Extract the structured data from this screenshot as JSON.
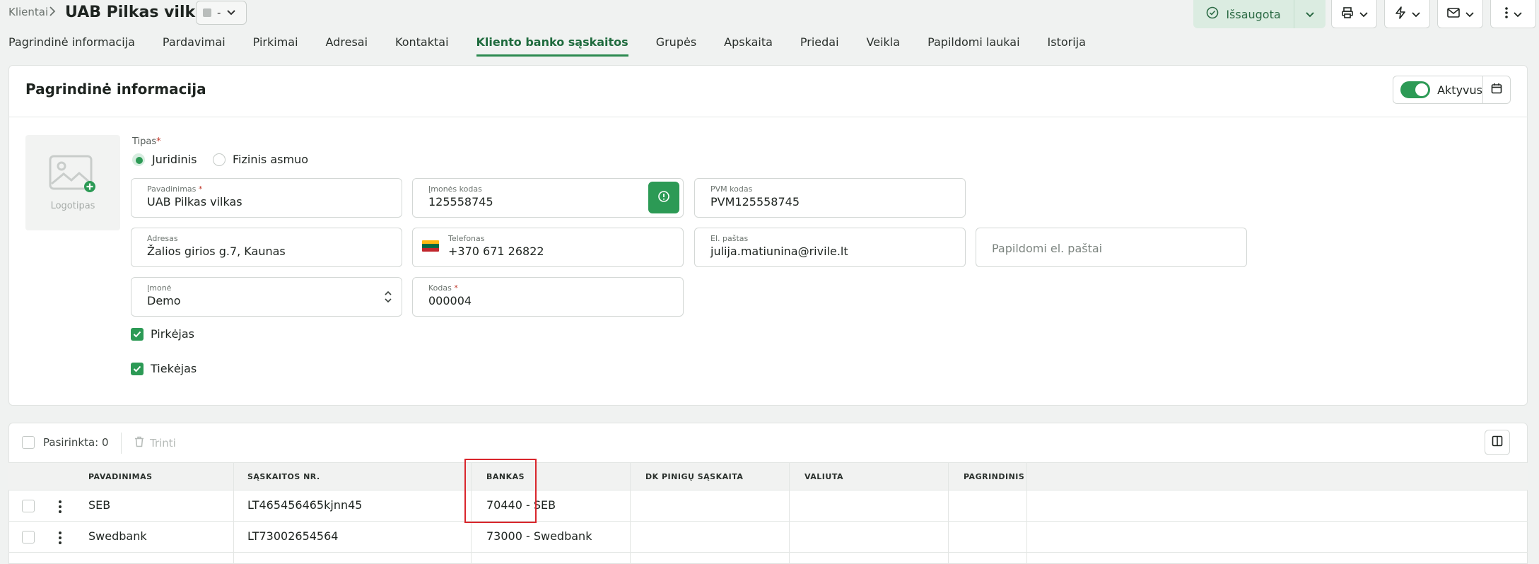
{
  "header": {
    "breadcrumb": "Klientai",
    "title": "UAB Pilkas vilkas",
    "status_value": "-",
    "saved_label": "Išsaugota"
  },
  "tabs": [
    {
      "label": "Pagrindinė informacija"
    },
    {
      "label": "Pardavimai"
    },
    {
      "label": "Pirkimai"
    },
    {
      "label": "Adresai"
    },
    {
      "label": "Kontaktai"
    },
    {
      "label": "Kliento banko sąskaitos",
      "active": true
    },
    {
      "label": "Grupės"
    },
    {
      "label": "Apskaita"
    },
    {
      "label": "Priedai"
    },
    {
      "label": "Veikla"
    },
    {
      "label": "Papildomi laukai"
    },
    {
      "label": "Istorija"
    }
  ],
  "main_card": {
    "title": "Pagrindinė informacija",
    "active_label": "Aktyvus",
    "logo_label": "Logotipas",
    "type_label": "Tipas",
    "type_options": [
      "Juridinis",
      "Fizinis asmuo"
    ],
    "fields": {
      "name": {
        "label": "Pavadinimas",
        "value": "UAB Pilkas vilkas"
      },
      "company_code": {
        "label": "Įmonės kodas",
        "value": "125558745"
      },
      "vat_code": {
        "label": "PVM kodas",
        "value": "PVM125558745"
      },
      "address": {
        "label": "Adresas",
        "value": "Žalios girios g.7, Kaunas"
      },
      "phone": {
        "label": "Telefonas",
        "value": "+370 671 26822"
      },
      "email": {
        "label": "El. paštas",
        "value": "julija.matiunina@rivile.lt"
      },
      "extra_emails": {
        "placeholder": "Papildomi el. paštai"
      },
      "company": {
        "label": "Įmonė",
        "value": "Demo"
      },
      "code": {
        "label": "Kodas",
        "value": "000004"
      }
    },
    "checkboxes": [
      {
        "label": "Pirkėjas",
        "checked": true
      },
      {
        "label": "Tiekėjas",
        "checked": true
      }
    ]
  },
  "table": {
    "selected_label": "Pasirinkta: 0",
    "delete_label": "Trinti",
    "columns": [
      "PAVADINIMAS",
      "SĄSKAITOS NR.",
      "BANKAS",
      "DK PINIGŲ SĄSKAITA",
      "VALIUTA",
      "PAGRINDINIS"
    ],
    "rows": [
      {
        "name": "SEB",
        "account": "LT465456465kjnn45",
        "bank": "70440 - SEB",
        "dk": "",
        "currency": "",
        "main": ""
      },
      {
        "name": "Swedbank",
        "account": "LT73002654564",
        "bank": "73000 - Swedbank",
        "dk": "",
        "currency": "",
        "main": ""
      }
    ]
  },
  "colors": {
    "accent": "#2c9a55",
    "highlight": "#d9262c"
  }
}
